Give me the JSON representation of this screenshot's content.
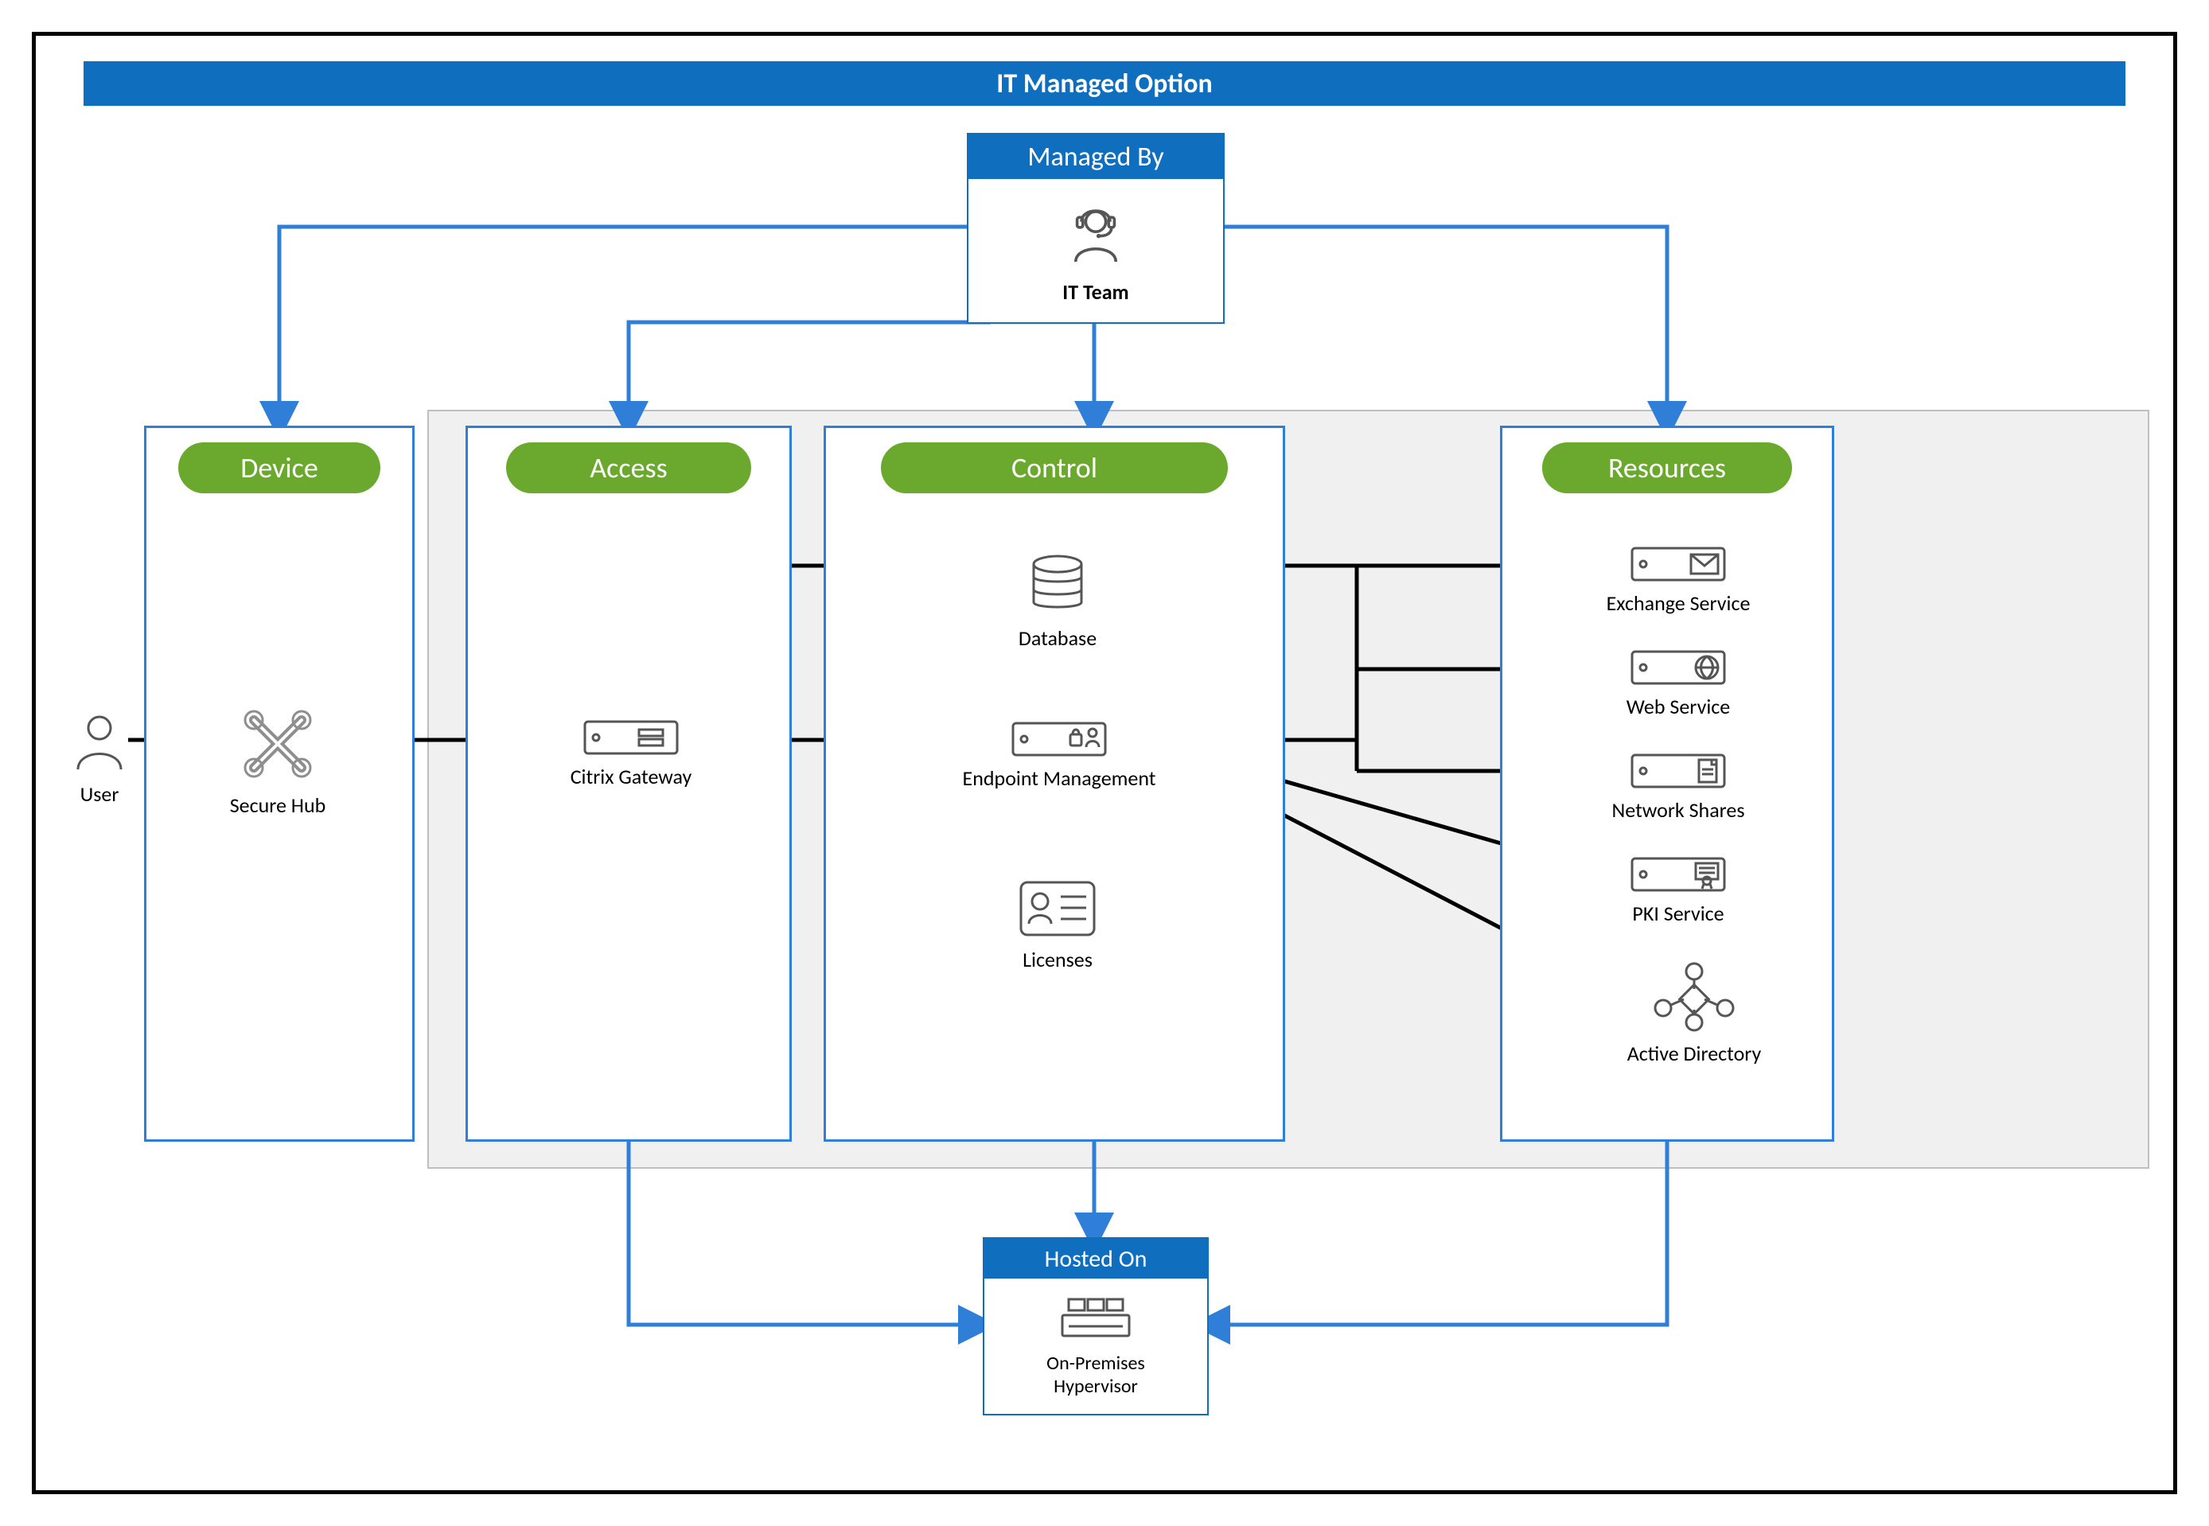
{
  "title": "IT Managed Option",
  "managed_by": {
    "header": "Managed By",
    "label": "IT Team"
  },
  "lanes": {
    "device": "Device",
    "access": "Access",
    "control": "Control",
    "resources": "Resources"
  },
  "nodes": {
    "user": "User",
    "secure_hub": "Secure Hub",
    "gateway": "Citrix Gateway",
    "database": "Database",
    "endpoint": "Endpoint Management",
    "licenses": "Licenses"
  },
  "resources": {
    "exchange": "Exchange Service",
    "web": "Web Service",
    "network": "Network Shares",
    "pki": "PKI Service",
    "ad": "Active Directory"
  },
  "hosted": {
    "header": "Hosted On",
    "label": "On-Premises Hypervisor"
  }
}
